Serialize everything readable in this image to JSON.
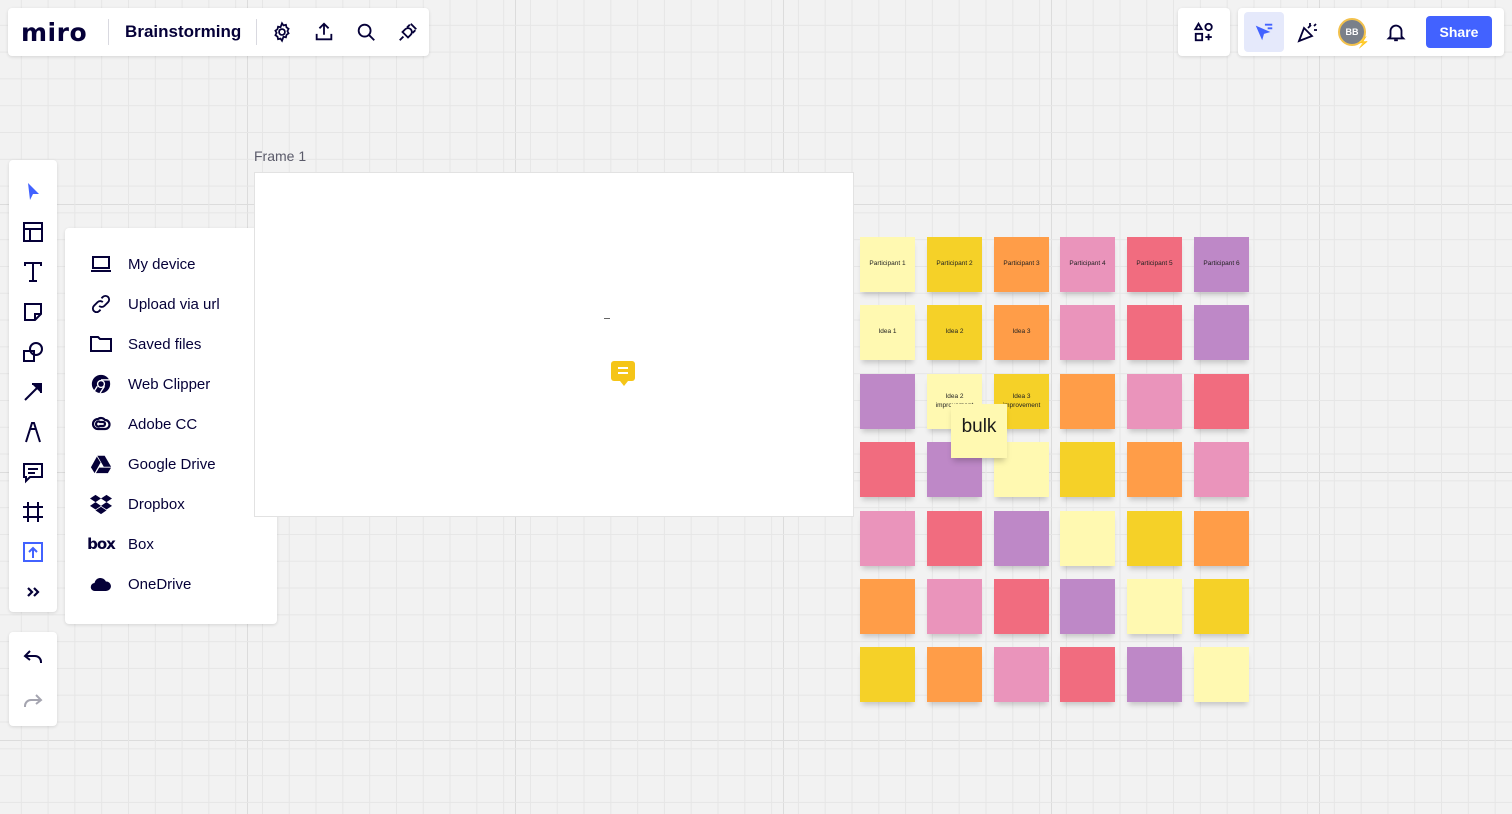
{
  "header": {
    "logo": "miro",
    "board_title": "Brainstorming",
    "icons": [
      "settings-icon",
      "export-icon",
      "search-icon",
      "plugin-icon"
    ]
  },
  "right_bar": {
    "avatar_initials": "BB",
    "share_label": "Share",
    "icons": [
      "apps-icon",
      "collaborator-cursors-icon",
      "celebrate-icon",
      "notifications-icon"
    ]
  },
  "left_toolbar": {
    "tools": [
      "select",
      "templates",
      "text",
      "sticky-note",
      "shapes",
      "connection-line",
      "pen",
      "comment",
      "frame",
      "upload",
      "more-tools"
    ],
    "active_tool": "upload"
  },
  "upload_menu": {
    "items": [
      {
        "label": "My device",
        "icon": "laptop-icon"
      },
      {
        "label": "Upload via url",
        "icon": "link-icon"
      },
      {
        "label": "Saved files",
        "icon": "folder-icon"
      },
      {
        "label": "Web Clipper",
        "icon": "chrome-icon"
      },
      {
        "label": "Adobe CC",
        "icon": "adobe-cc-icon"
      },
      {
        "label": "Google Drive",
        "icon": "google-drive-icon"
      },
      {
        "label": "Dropbox",
        "icon": "dropbox-icon"
      },
      {
        "label": "Box",
        "icon": "box-icon"
      },
      {
        "label": "OneDrive",
        "icon": "onedrive-icon"
      }
    ]
  },
  "frame": {
    "label": "Frame 1"
  },
  "colors": {
    "accent": "#4262ff",
    "light_yellow": "#fff9b1",
    "yellow": "#f5d128",
    "orange": "#ff9d48",
    "light_pink": "#ea94bb",
    "red": "#f16c7f",
    "violet": "#be88c7"
  },
  "stickies": {
    "rows": [
      [
        {
          "c": "light_yellow",
          "t": "Participant 1"
        },
        {
          "c": "yellow",
          "t": "Participant 2"
        },
        {
          "c": "orange",
          "t": "Participant 3"
        },
        {
          "c": "light_pink",
          "t": "Participant 4"
        },
        {
          "c": "red",
          "t": "Participant 5"
        },
        {
          "c": "violet",
          "t": "Participant 6"
        }
      ],
      [
        {
          "c": "light_yellow",
          "t": "Idea 1"
        },
        {
          "c": "yellow",
          "t": "Idea 2"
        },
        {
          "c": "orange",
          "t": "Idea 3"
        },
        {
          "c": "light_pink",
          "t": ""
        },
        {
          "c": "red",
          "t": ""
        },
        {
          "c": "violet",
          "t": ""
        }
      ],
      [
        {
          "c": "violet",
          "t": ""
        },
        {
          "c": "light_yellow",
          "t": "Idea 2 improvement"
        },
        {
          "c": "yellow",
          "t": "Idea 3 improvement"
        },
        {
          "c": "orange",
          "t": ""
        },
        {
          "c": "light_pink",
          "t": ""
        },
        {
          "c": "red",
          "t": ""
        }
      ],
      [
        {
          "c": "red",
          "t": ""
        },
        {
          "c": "violet",
          "t": ""
        },
        {
          "c": "light_yellow",
          "t": ""
        },
        {
          "c": "yellow",
          "t": ""
        },
        {
          "c": "orange",
          "t": ""
        },
        {
          "c": "light_pink",
          "t": ""
        }
      ],
      [
        {
          "c": "light_pink",
          "t": ""
        },
        {
          "c": "red",
          "t": ""
        },
        {
          "c": "violet",
          "t": ""
        },
        {
          "c": "light_yellow",
          "t": ""
        },
        {
          "c": "yellow",
          "t": ""
        },
        {
          "c": "orange",
          "t": ""
        }
      ],
      [
        {
          "c": "orange",
          "t": ""
        },
        {
          "c": "light_pink",
          "t": ""
        },
        {
          "c": "red",
          "t": ""
        },
        {
          "c": "violet",
          "t": ""
        },
        {
          "c": "light_yellow",
          "t": ""
        },
        {
          "c": "yellow",
          "t": ""
        }
      ],
      [
        {
          "c": "yellow",
          "t": ""
        },
        {
          "c": "orange",
          "t": ""
        },
        {
          "c": "light_pink",
          "t": ""
        },
        {
          "c": "red",
          "t": ""
        },
        {
          "c": "violet",
          "t": ""
        },
        {
          "c": "light_yellow",
          "t": ""
        }
      ]
    ],
    "floating_note": "bulk"
  }
}
